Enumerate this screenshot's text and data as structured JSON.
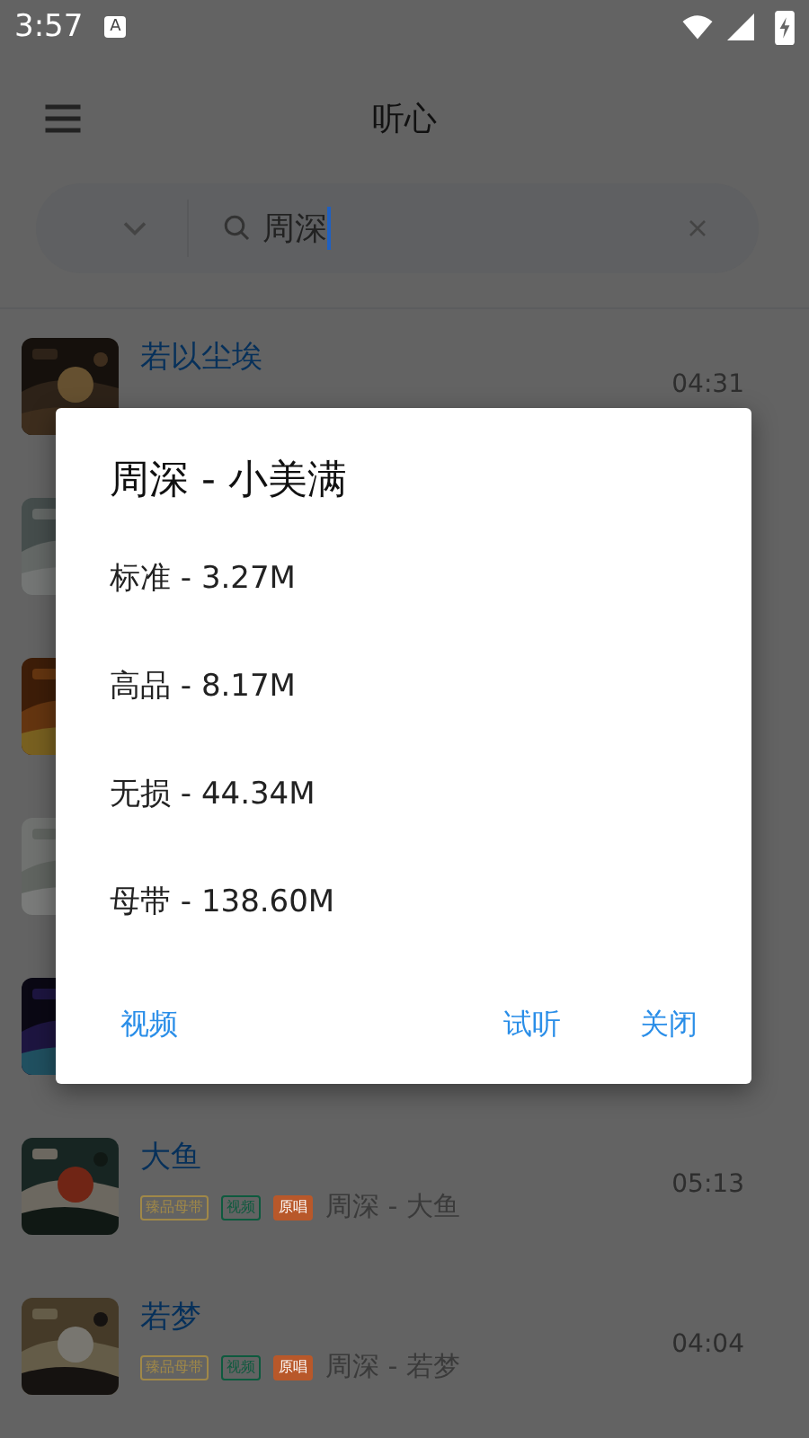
{
  "status_bar": {
    "time": "3:57",
    "badge": "A"
  },
  "app_bar": {
    "title": "听心"
  },
  "search": {
    "value": "周深"
  },
  "songs": [
    {
      "kind": "song",
      "title": "若以尘埃",
      "time": "04:31"
    },
    {
      "kind": "picture"
    },
    {
      "kind": "picture"
    },
    {
      "kind": "picture"
    },
    {
      "kind": "picture"
    },
    {
      "kind": "song",
      "title": "大鱼",
      "time": "05:13",
      "tags": [
        {
          "label": "臻品母带",
          "color": "#a08848",
          "kind": "outline"
        },
        {
          "label": "视频",
          "color": "#0e5a3e",
          "kind": "outline"
        },
        {
          "label": "原唱",
          "color": "#b8582a",
          "kind": "filled"
        }
      ],
      "subtitle": "周深 - 大鱼"
    },
    {
      "kind": "song",
      "title": "若梦",
      "time": "04:04",
      "tags": [
        {
          "label": "臻品母带",
          "color": "#a08848",
          "kind": "outline"
        },
        {
          "label": "视频",
          "color": "#0e5a3e",
          "kind": "outline"
        },
        {
          "label": "原唱",
          "color": "#b8582a",
          "kind": "filled"
        }
      ],
      "subtitle": "周深 - 若梦"
    }
  ],
  "dialog": {
    "title": "周深 - 小美满",
    "options": [
      "标准 - 3.27M",
      "高品 - 8.17M",
      "无损 - 44.34M",
      "母带 - 138.60M"
    ],
    "left_buttons": [
      "视频"
    ],
    "right_buttons": [
      "试听",
      "关闭"
    ]
  }
}
